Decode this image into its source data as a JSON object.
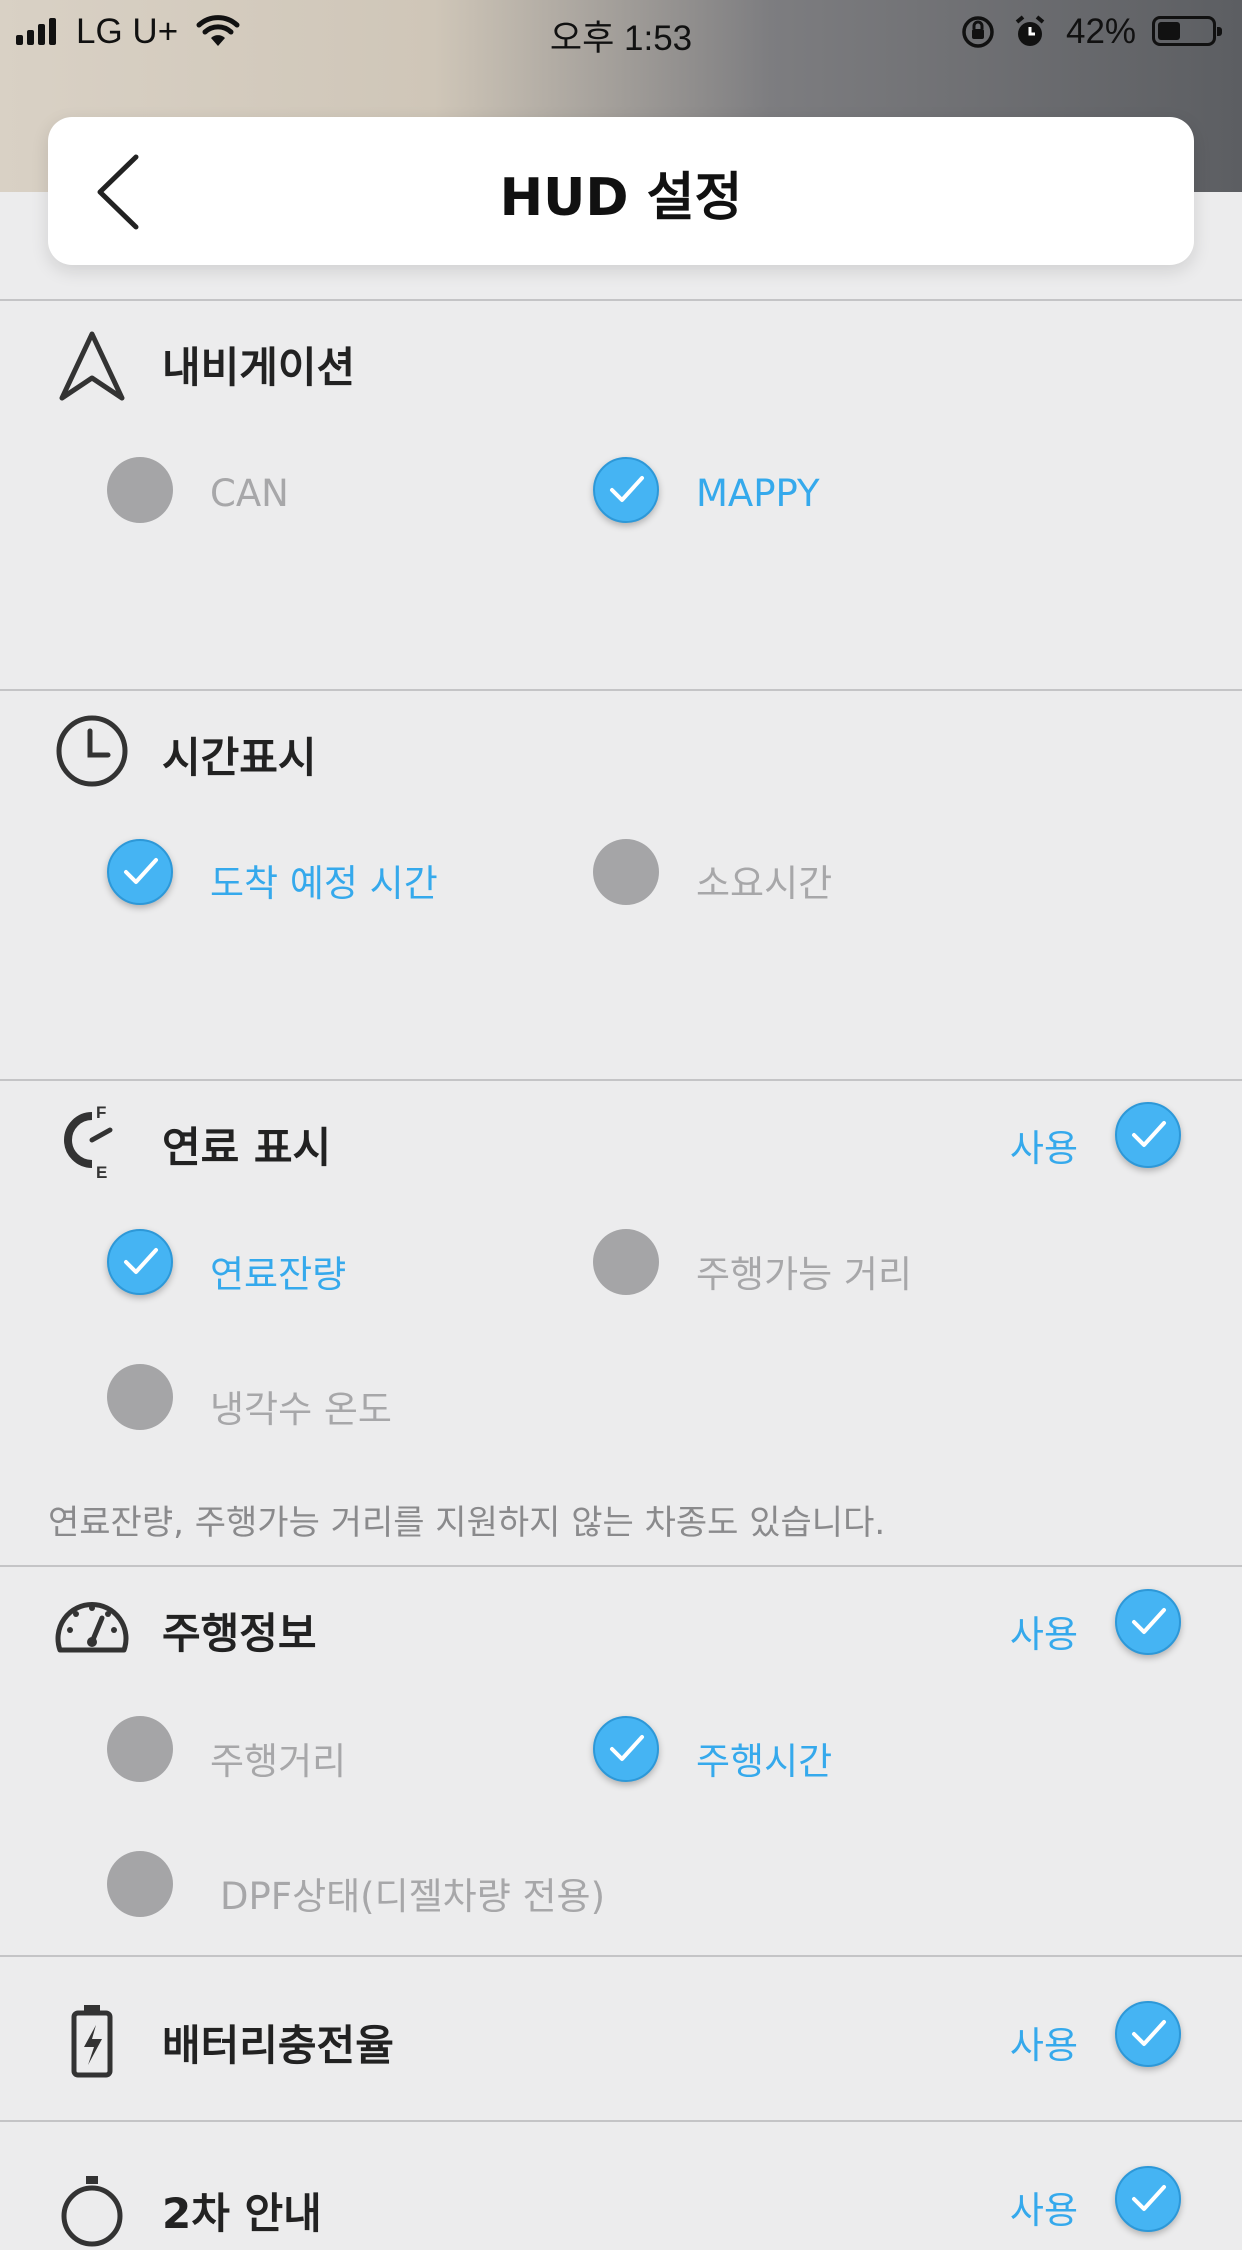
{
  "status_bar": {
    "carrier": "LG U+",
    "time": "오후 1:53",
    "battery_percent": "42%",
    "battery_level": 0.42
  },
  "header": {
    "title": "HUD 설정"
  },
  "sections": {
    "navigation": {
      "title": "내비게이션",
      "options": [
        {
          "label": "CAN",
          "selected": false
        },
        {
          "label": "MAPPY",
          "selected": true
        }
      ]
    },
    "time_display": {
      "title": "시간표시",
      "options": [
        {
          "label": "도착 예정 시간",
          "selected": true
        },
        {
          "label": "소요시간",
          "selected": false
        }
      ]
    },
    "fuel_display": {
      "title": "연료 표시",
      "use_label": "사용",
      "enabled": true,
      "options": [
        {
          "label": "연료잔량",
          "selected": true
        },
        {
          "label": "주행가능 거리",
          "selected": false
        },
        {
          "label": "냉각수 온도",
          "selected": false
        }
      ],
      "note": "연료잔량, 주행가능 거리를 지원하지 않는 차종도 있습니다."
    },
    "drive_info": {
      "title": "주행정보",
      "use_label": "사용",
      "enabled": true,
      "options": [
        {
          "label": "주행거리",
          "selected": false
        },
        {
          "label": "주행시간",
          "selected": true
        },
        {
          "label": "DPF상태(디젤차량 전용)",
          "selected": false
        }
      ]
    },
    "battery_charge": {
      "title": "배터리충전율",
      "use_label": "사용",
      "enabled": true
    },
    "secondary_guide": {
      "title": "2차 안내",
      "use_label": "사용",
      "enabled": true
    }
  },
  "colors": {
    "accent": "#35a9ec",
    "toggle_on": "#45b4f3",
    "toggle_off": "#a5a5a7",
    "background": "#ececed"
  },
  "icons": [
    "navigation-arrow-icon",
    "clock-icon",
    "fuel-gauge-icon",
    "speedometer-icon",
    "battery-icon",
    "stopwatch-icon"
  ]
}
